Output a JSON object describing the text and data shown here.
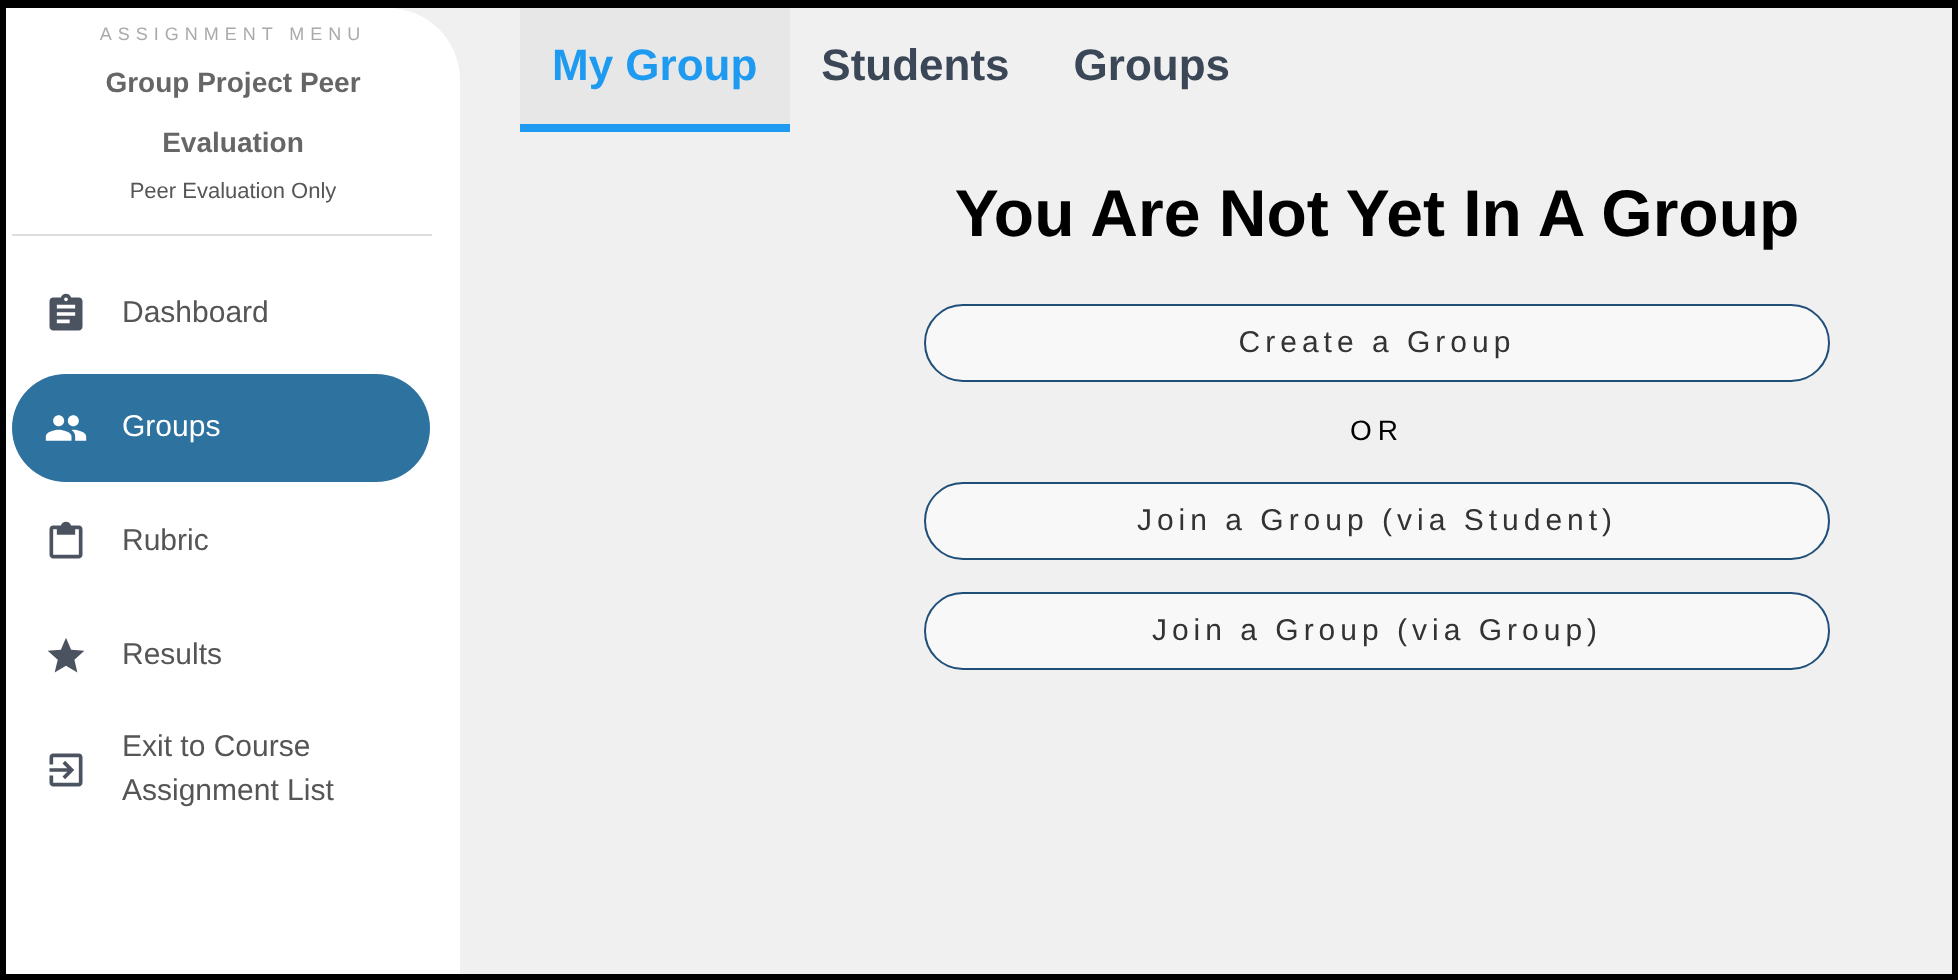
{
  "sidebar": {
    "caption": "ASSIGNMENT MENU",
    "title": "Group Project Peer Evaluation",
    "subtitle": "Peer Evaluation Only",
    "items": [
      {
        "label": "Dashboard",
        "selected": false
      },
      {
        "label": "Groups",
        "selected": true
      },
      {
        "label": "Rubric",
        "selected": false
      },
      {
        "label": "Results",
        "selected": false
      },
      {
        "label": "Exit to Course Assignment List",
        "selected": false
      }
    ]
  },
  "tabs": [
    {
      "label": "My Group",
      "selected": true
    },
    {
      "label": "Students",
      "selected": false
    },
    {
      "label": "Groups",
      "selected": false
    }
  ],
  "heading": "You Are Not Yet In A Group",
  "actions": [
    {
      "kind": "button",
      "label": "Create a Group"
    },
    {
      "kind": "separator",
      "label": "OR"
    },
    {
      "kind": "button",
      "label": "Join a Group (via Student)"
    },
    {
      "kind": "button",
      "label": "Join a Group (via Group)"
    }
  ]
}
